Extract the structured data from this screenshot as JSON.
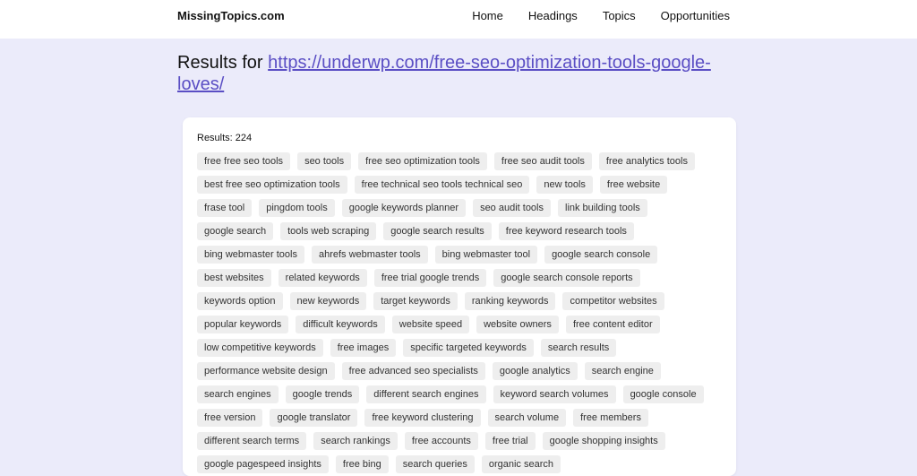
{
  "header": {
    "brand": "MissingTopics.com",
    "nav": [
      "Home",
      "Headings",
      "Topics",
      "Opportunities"
    ]
  },
  "results": {
    "prefix": "Results for",
    "url": "https://underwp.com/free-seo-optimization-tools-google-loves/",
    "count_label": "Results: 224"
  },
  "tags": [
    "free free seo tools",
    "seo tools",
    "free seo optimization tools",
    "free seo audit tools",
    "free analytics tools",
    "best free seo optimization tools",
    "free technical seo tools technical seo",
    "new tools",
    "free website",
    "frase tool",
    "pingdom tools",
    "google keywords planner",
    "seo audit tools",
    "link building tools",
    "google search",
    "tools web scraping",
    "google search results",
    "free keyword research tools",
    "bing webmaster tools",
    "ahrefs webmaster tools",
    "bing webmaster tool",
    "google search console",
    "best websites",
    "related keywords",
    "free trial google trends",
    "google search console reports",
    "keywords option",
    "new keywords",
    "target keywords",
    "ranking keywords",
    "competitor websites",
    "popular keywords",
    "difficult keywords",
    "website speed",
    "website owners",
    "free content editor",
    "low competitive keywords",
    "free images",
    "specific targeted keywords",
    "search results",
    "performance website design",
    "free advanced seo specialists",
    "google analytics",
    "search engine",
    "search engines",
    "google trends",
    "different search engines",
    "keyword search volumes",
    "google console",
    "free version",
    "google translator",
    "free keyword clustering",
    "search volume",
    "free members",
    "different search terms",
    "search rankings",
    "free accounts",
    "free trial",
    "google shopping insights",
    "google pagespeed insights",
    "free bing",
    "search queries",
    "organic search"
  ]
}
